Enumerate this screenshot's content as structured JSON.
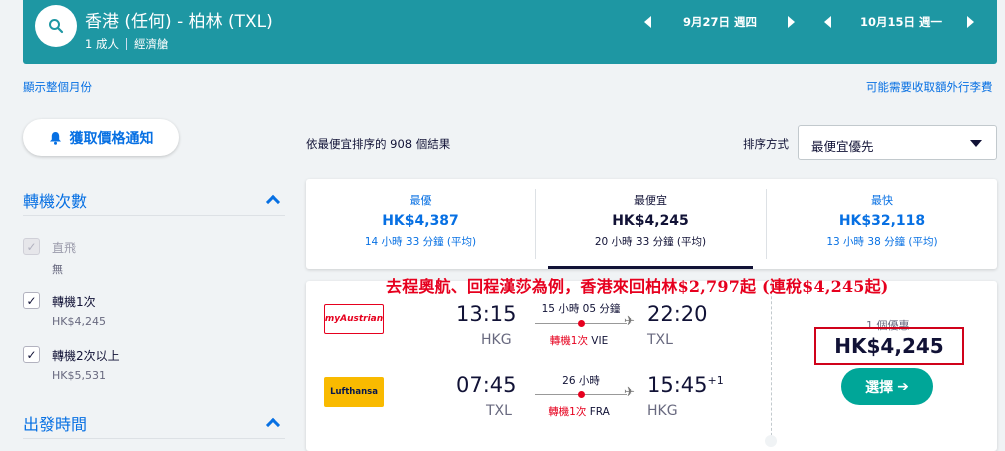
{
  "header": {
    "route": "香港 (任何) - 柏林 (TXL)",
    "passengers": "1 成人",
    "cabin": "經濟艙",
    "depart_date": "9月27日 週四",
    "return_date": "10月15日 週一"
  },
  "links": {
    "show_month": "顯示整個月份",
    "extra_fees": "可能需要收取額外行李費"
  },
  "sidebar": {
    "price_alert": "獲取價格通知",
    "stops_title": "轉機次數",
    "stops": [
      {
        "label": "直飛",
        "sub": "無",
        "checked": true,
        "disabled": true
      },
      {
        "label": "轉機1次",
        "sub": "HK$4,245",
        "checked": true,
        "disabled": false
      },
      {
        "label": "轉機2次以上",
        "sub": "HK$5,531",
        "checked": true,
        "disabled": false
      }
    ],
    "depart_title": "出發時間"
  },
  "results": {
    "count_text": "依最便宜排序的 908 個結果",
    "sort_label": "排序方式",
    "sort_value": "最便宜優先"
  },
  "tabs": [
    {
      "title": "最優",
      "price": "HK$4,387",
      "duration": "14 小時 33 分鐘 (平均)"
    },
    {
      "title": "最便宜",
      "price": "HK$4,245",
      "duration": "20 小時 33 分鐘 (平均)"
    },
    {
      "title": "最快",
      "price": "HK$32,118",
      "duration": "13 小時 38 分鐘 (平均)"
    }
  ],
  "annotation": "去程奧航、回程漢莎為例，香港來回柏林$2,797起 (連稅$4,245起)",
  "itinerary": {
    "outbound": {
      "airline": "myAustrian",
      "depart_time": "13:15",
      "depart_code": "HKG",
      "duration": "15 小時 05 分鐘",
      "stops": "轉機1次",
      "via": "VIE",
      "arrive_time": "22:20",
      "arrive_code": "TXL",
      "day_offset": ""
    },
    "inbound": {
      "airline": "Lufthansa",
      "depart_time": "07:45",
      "depart_code": "TXL",
      "duration": "26 小時",
      "stops": "轉機1次",
      "via": "FRA",
      "arrive_time": "15:45",
      "arrive_code": "HKG",
      "day_offset": "+1"
    },
    "deals": "1 個優惠",
    "price": "HK$4,245",
    "select": "選擇",
    "select_arrow": "➔"
  },
  "colors": {
    "header": "#1e97a3",
    "link": "#0770e3",
    "select_button": "#00a698",
    "annotation": "#e6001e"
  }
}
